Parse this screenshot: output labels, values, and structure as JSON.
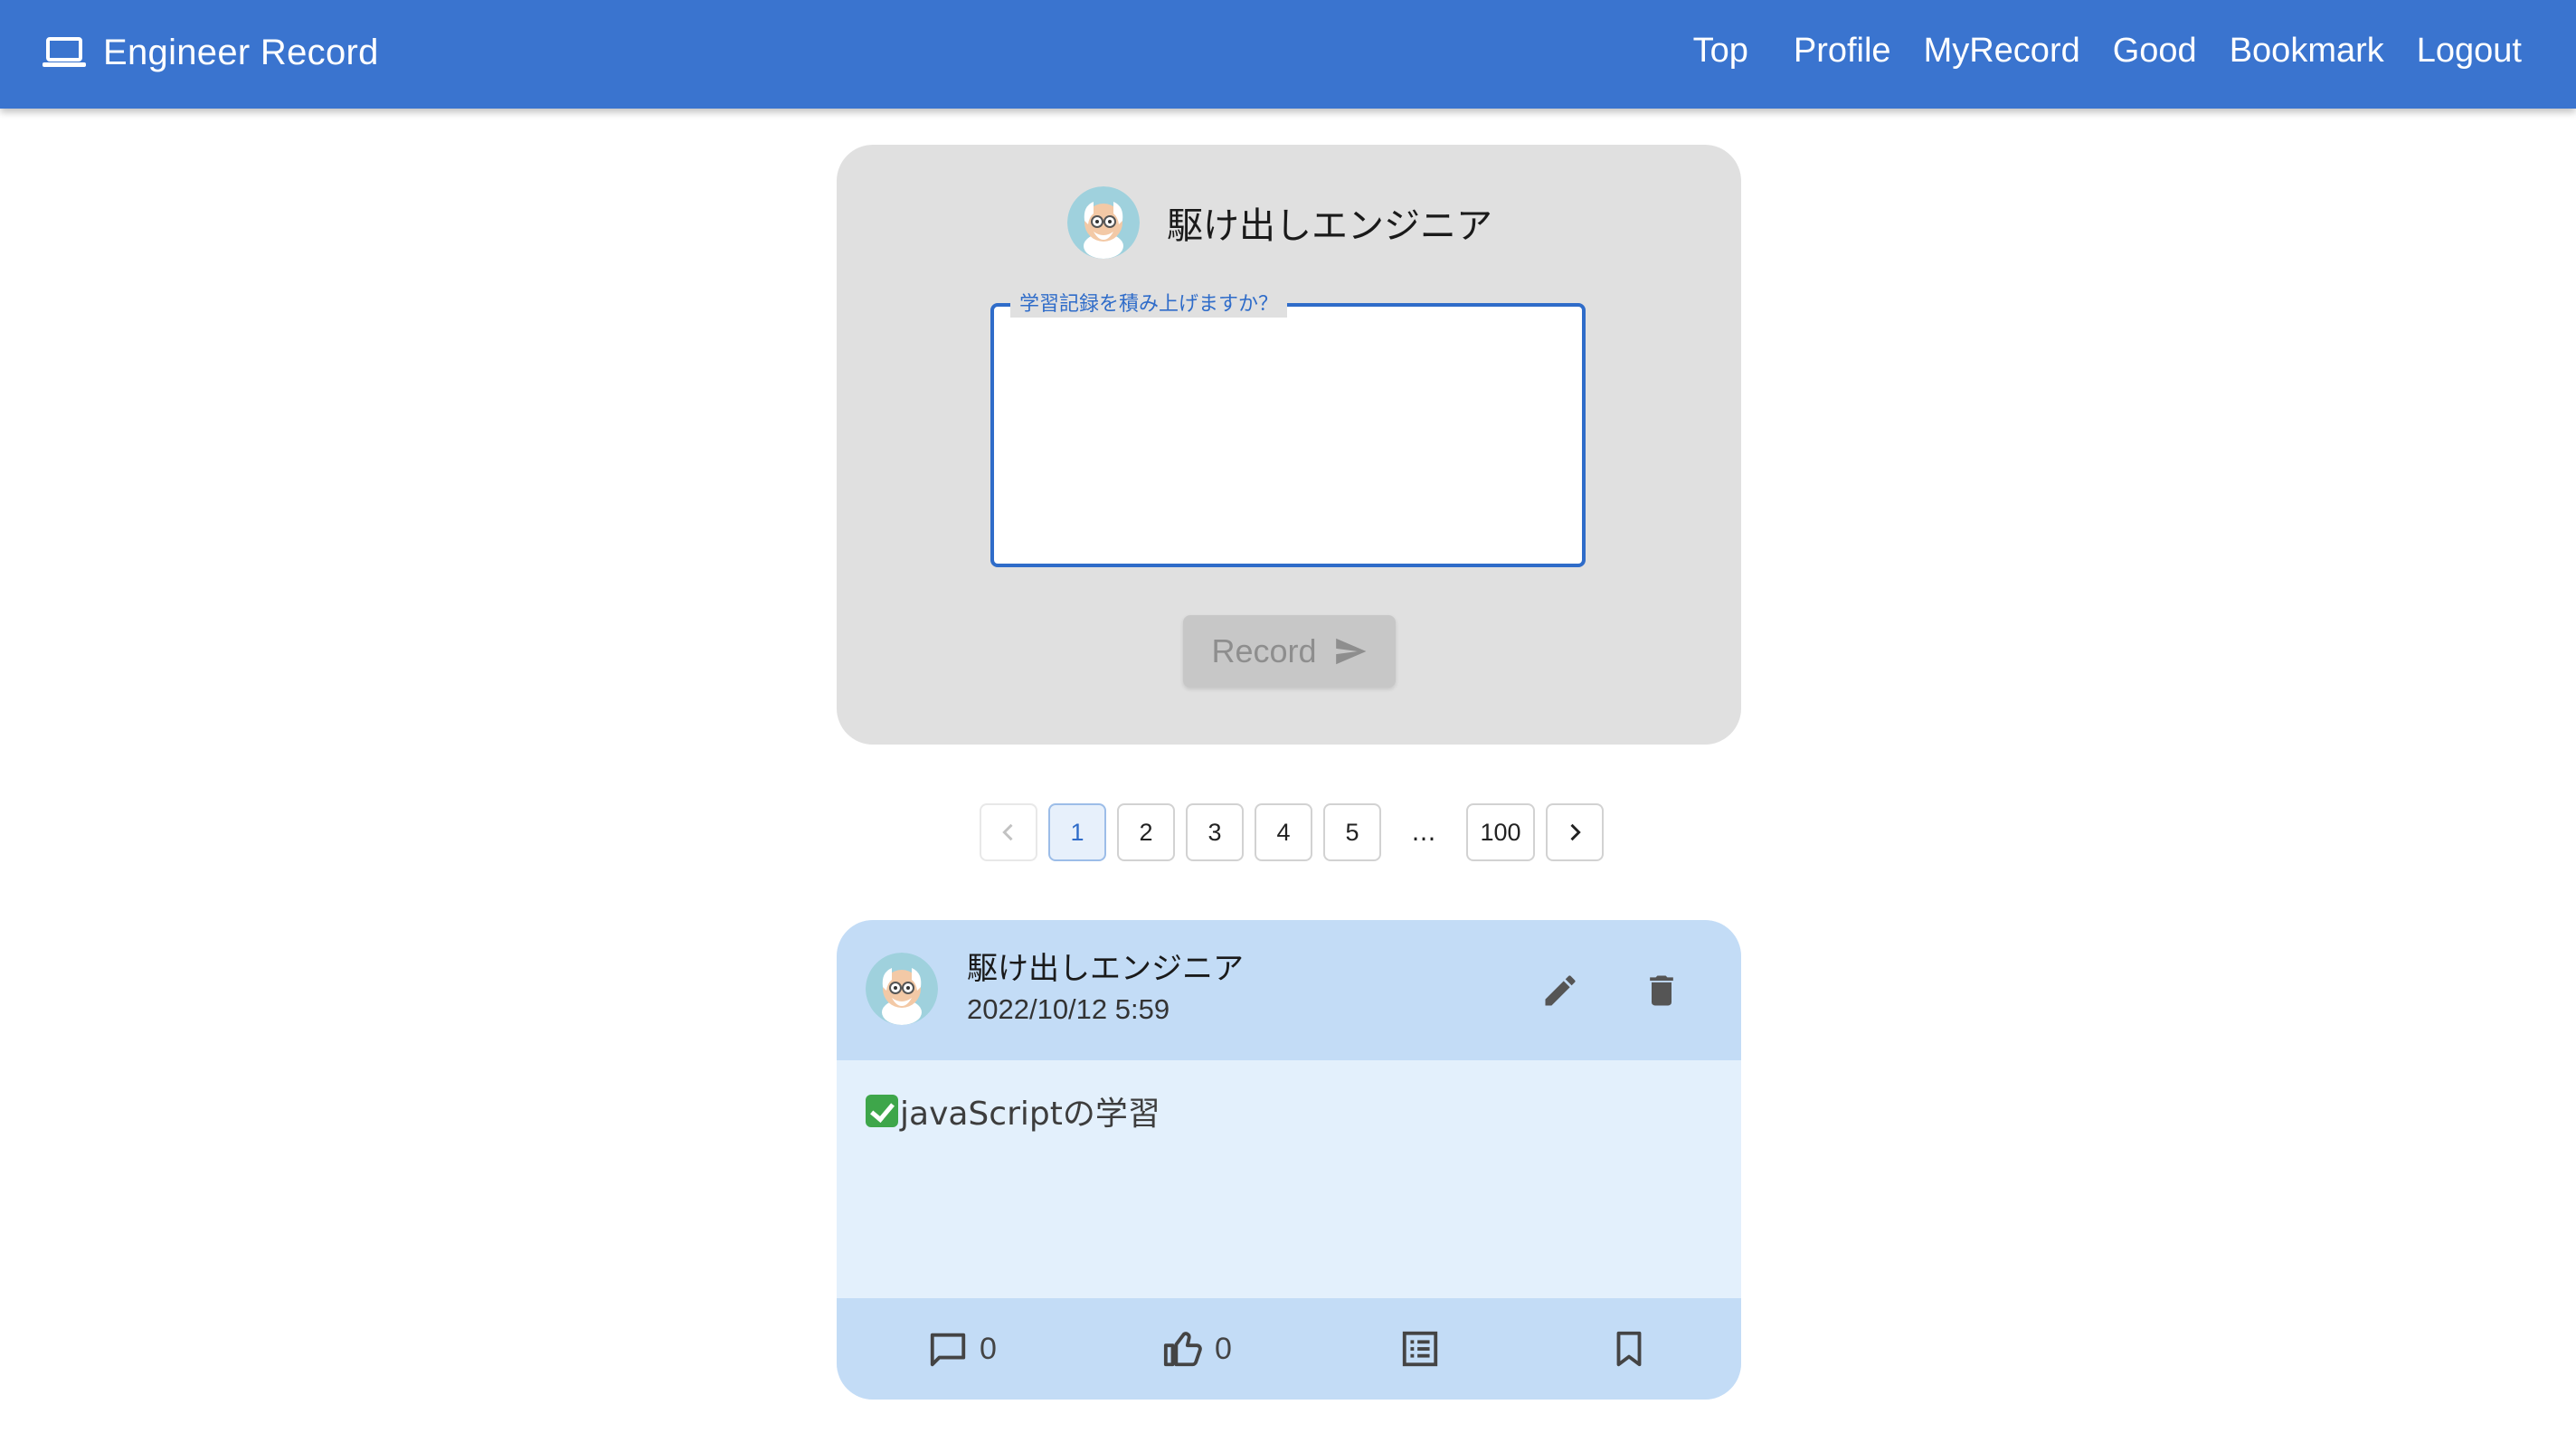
{
  "app": {
    "title": "Engineer Record",
    "brand_color": "#3a74cf"
  },
  "nav": {
    "items": [
      "Top",
      "Profile",
      "MyRecord",
      "Good",
      "Bookmark",
      "Logout"
    ]
  },
  "compose": {
    "user_name": "駆け出しエンジニア",
    "input_label": "学習記録を積み上げますか？",
    "input_value": "",
    "submit_label": "Record",
    "submit_disabled": true
  },
  "pagination": {
    "pages": [
      "1",
      "2",
      "3",
      "4",
      "5"
    ],
    "ellipsis": "…",
    "last_page": "100",
    "current_page": "1",
    "prev_icon": "chevron-left-icon",
    "next_icon": "chevron-right-icon"
  },
  "post": {
    "author": "駆け出しエンジニア",
    "date": "2022/10/12 5:59",
    "body": "javaScriptの学習",
    "comment_count": "0",
    "good_count": "0",
    "icons": {
      "edit": "pencil-icon",
      "delete": "trash-icon",
      "comment": "comment-icon",
      "good": "thumb-up-icon",
      "detail": "list-icon",
      "bookmark": "bookmark-icon"
    }
  }
}
